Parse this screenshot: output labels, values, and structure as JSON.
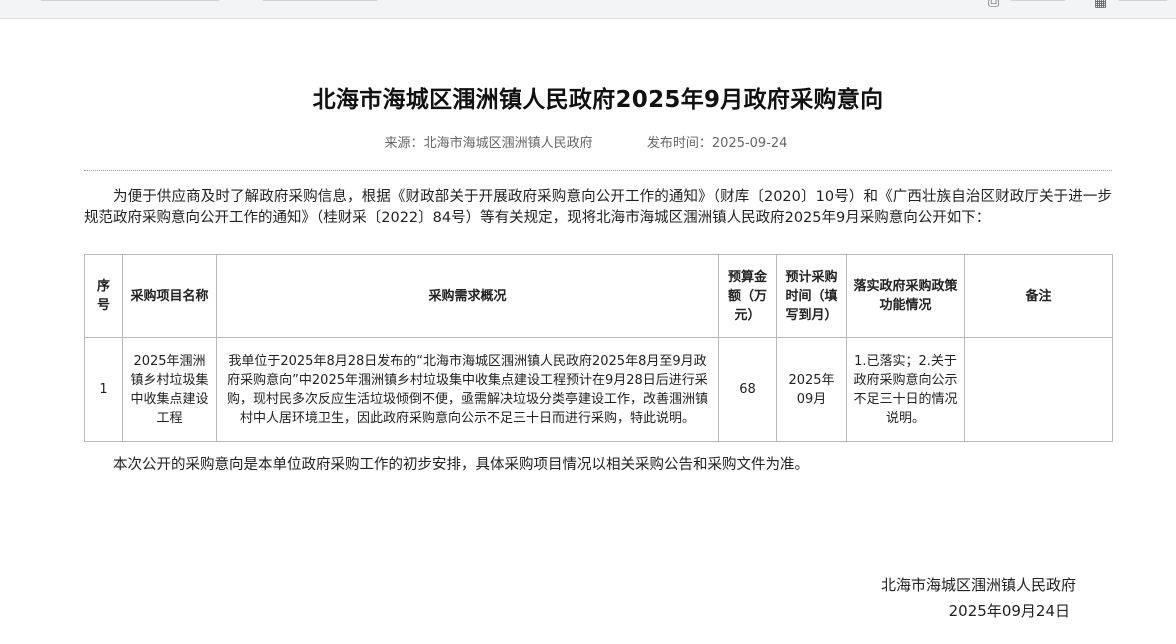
{
  "title": "北海市海城区涠洲镇人民政府2025年9月政府采购意向",
  "meta": {
    "source_label": "来源：",
    "source": "北海市海城区涠洲镇人民政府",
    "publish_label": "发布时间：",
    "publish_time": "2025-09-24"
  },
  "intro": "为便于供应商及时了解政府采购信息，根据《财政部关于开展政府采购意向公开工作的通知》（财库〔2020〕10号）和《广西壮族自治区财政厅关于进一步规范政府采购意向公开工作的通知》（桂财采〔2022〕84号）等有关规定，现将北海市海城区涠洲镇人民政府2025年9月采购意向公开如下：",
  "table": {
    "headers": [
      "序号",
      "采购项目名称",
      "采购需求概况",
      "预算金额（万元）",
      "预计采购时间（填写到月）",
      "落实政府采购政策功能情况",
      "备注"
    ],
    "rows": [
      {
        "index": "1",
        "name": "2025年涠洲镇乡村垃圾集中收集点建设工程",
        "summary": "我单位于2025年8月28日发布的“北海市海城区涠洲镇人民政府2025年8月至9月政府采购意向”中2025年涠洲镇乡村垃圾集中收集点建设工程预计在9月28日后进行采购，现村民多次反应生活垃圾倾倒不便，亟需解决垃圾分类亭建设工作，改善涠洲镇村中人居环境卫生，因此政府采购意向公示不足三十日而进行采购，特此说明。",
        "budget": "68",
        "time": "2025年09月",
        "policy": "1.已落实；2.关于政府采购意向公示不足三十日的情况说明。",
        "remark": ""
      }
    ]
  },
  "footnote": "本次公开的采购意向是本单位政府采购工作的初步安排，具体采购项目情况以相关采购公告和采购文件为准。",
  "signature": "北海市海城区涠洲镇人民政府",
  "sign_date": "2025年09月24日"
}
